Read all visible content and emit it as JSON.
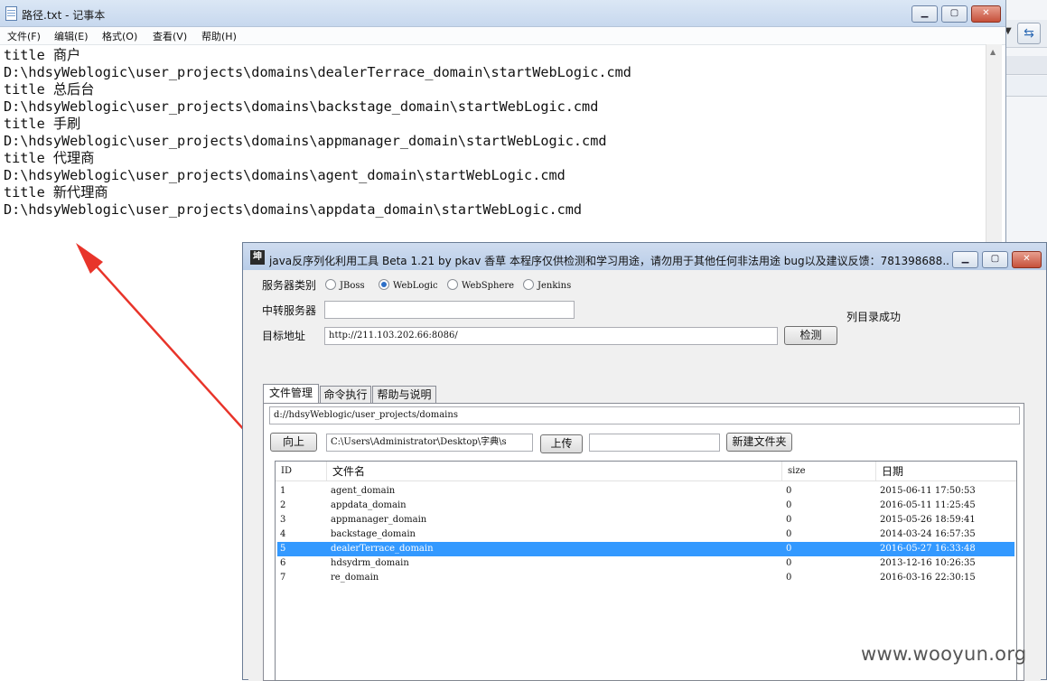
{
  "notepad": {
    "title": "路径.txt - 记事本",
    "menu": [
      "文件(F)",
      "编辑(E)",
      "格式(O)",
      "查看(V)",
      "帮助(H)"
    ],
    "lines": [
      "title 商户",
      "D:\\hdsyWeblogic\\user_projects\\domains\\dealerTerrace_domain\\startWebLogic.cmd",
      "title 总后台",
      "D:\\hdsyWeblogic\\user_projects\\domains\\backstage_domain\\startWebLogic.cmd",
      "title 手刷",
      "D:\\hdsyWeblogic\\user_projects\\domains\\appmanager_domain\\startWebLogic.cmd",
      "title 代理商",
      "D:\\hdsyWeblogic\\user_projects\\domains\\agent_domain\\startWebLogic.cmd",
      "title 新代理商",
      "D:\\hdsyWeblogic\\user_projects\\domains\\appdata_domain\\startWebLogic.cmd"
    ]
  },
  "tool": {
    "title": "java反序列化利用工具 Beta 1.21 by pkav 香草    本程序仅供检测和学习用途，请勿用于其他任何非法用途 bug以及建议反馈：781398688...",
    "server_type_label": "服务器类别",
    "server_types": [
      "JBoss",
      "WebLogic",
      "WebSphere",
      "Jenkins"
    ],
    "selected_server": "WebLogic",
    "relay_label": "中转服务器",
    "relay_value": "",
    "target_label": "目标地址",
    "target_value": "http://211.103.202.66:8086/",
    "check_button": "检测",
    "status": "列目录成功",
    "tabs": [
      "文件管理",
      "命令执行",
      "帮助与说明"
    ],
    "active_tab": "文件管理",
    "path_value": "d://hdsyWeblogic/user_projects/domains",
    "up_button": "向上",
    "upload_path": "C:\\Users\\Administrator\\Desktop\\字典\\s",
    "upload_button": "上传",
    "new_folder_value": "",
    "new_folder_button": "新建文件夹",
    "columns": [
      "ID",
      "文件名",
      "size",
      "日期"
    ],
    "rows": [
      {
        "id": "1",
        "name": "agent_domain",
        "size": "0",
        "date": "2015-06-11 17:50:53"
      },
      {
        "id": "2",
        "name": "appdata_domain",
        "size": "0",
        "date": "2016-05-11 11:25:45"
      },
      {
        "id": "3",
        "name": "appmanager_domain",
        "size": "0",
        "date": "2015-05-26 18:59:41"
      },
      {
        "id": "4",
        "name": "backstage_domain",
        "size": "0",
        "date": "2014-03-24 16:57:35"
      },
      {
        "id": "5",
        "name": "dealerTerrace_domain",
        "size": "0",
        "date": "2016-05-27 16:33:48"
      },
      {
        "id": "6",
        "name": "hdsydrm_domain",
        "size": "0",
        "date": "2013-12-16 10:26:35"
      },
      {
        "id": "7",
        "name": "re_domain",
        "size": "0",
        "date": "2016-03-16 22:30:15"
      }
    ],
    "selected_row": "5"
  },
  "watermark": "www.wooyun.org",
  "colors": {
    "selection": "#3399ff",
    "arrow": "#e8342a",
    "titlebar": "#c7d8ee"
  }
}
